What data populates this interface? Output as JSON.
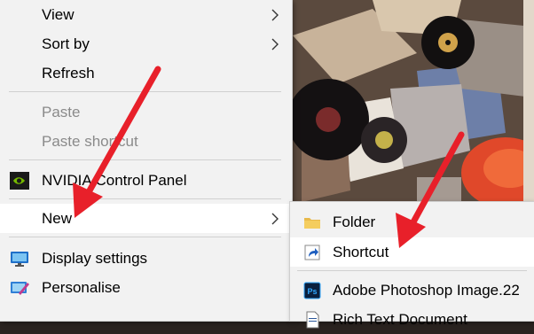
{
  "context_menu": {
    "view": "View",
    "sort_by": "Sort by",
    "refresh": "Refresh",
    "paste": "Paste",
    "paste_shortcut": "Paste shortcut",
    "nvidia": "NVIDIA Control Panel",
    "new": "New",
    "display_settings": "Display settings",
    "personalise": "Personalise"
  },
  "new_submenu": {
    "folder": "Folder",
    "shortcut": "Shortcut",
    "photoshop": "Adobe Photoshop Image.22",
    "rtf": "Rich Text Document"
  },
  "icons": [
    "chevron-right-icon",
    "nvidia-icon",
    "monitor-icon",
    "personalise-icon",
    "folder-icon",
    "shortcut-icon",
    "photoshop-icon",
    "document-icon"
  ],
  "colors": {
    "menu_bg": "#f2f2f2",
    "hover_bg": "#ffffff",
    "arrow": "#e8202a",
    "disabled_text": "#8a8a8a"
  }
}
